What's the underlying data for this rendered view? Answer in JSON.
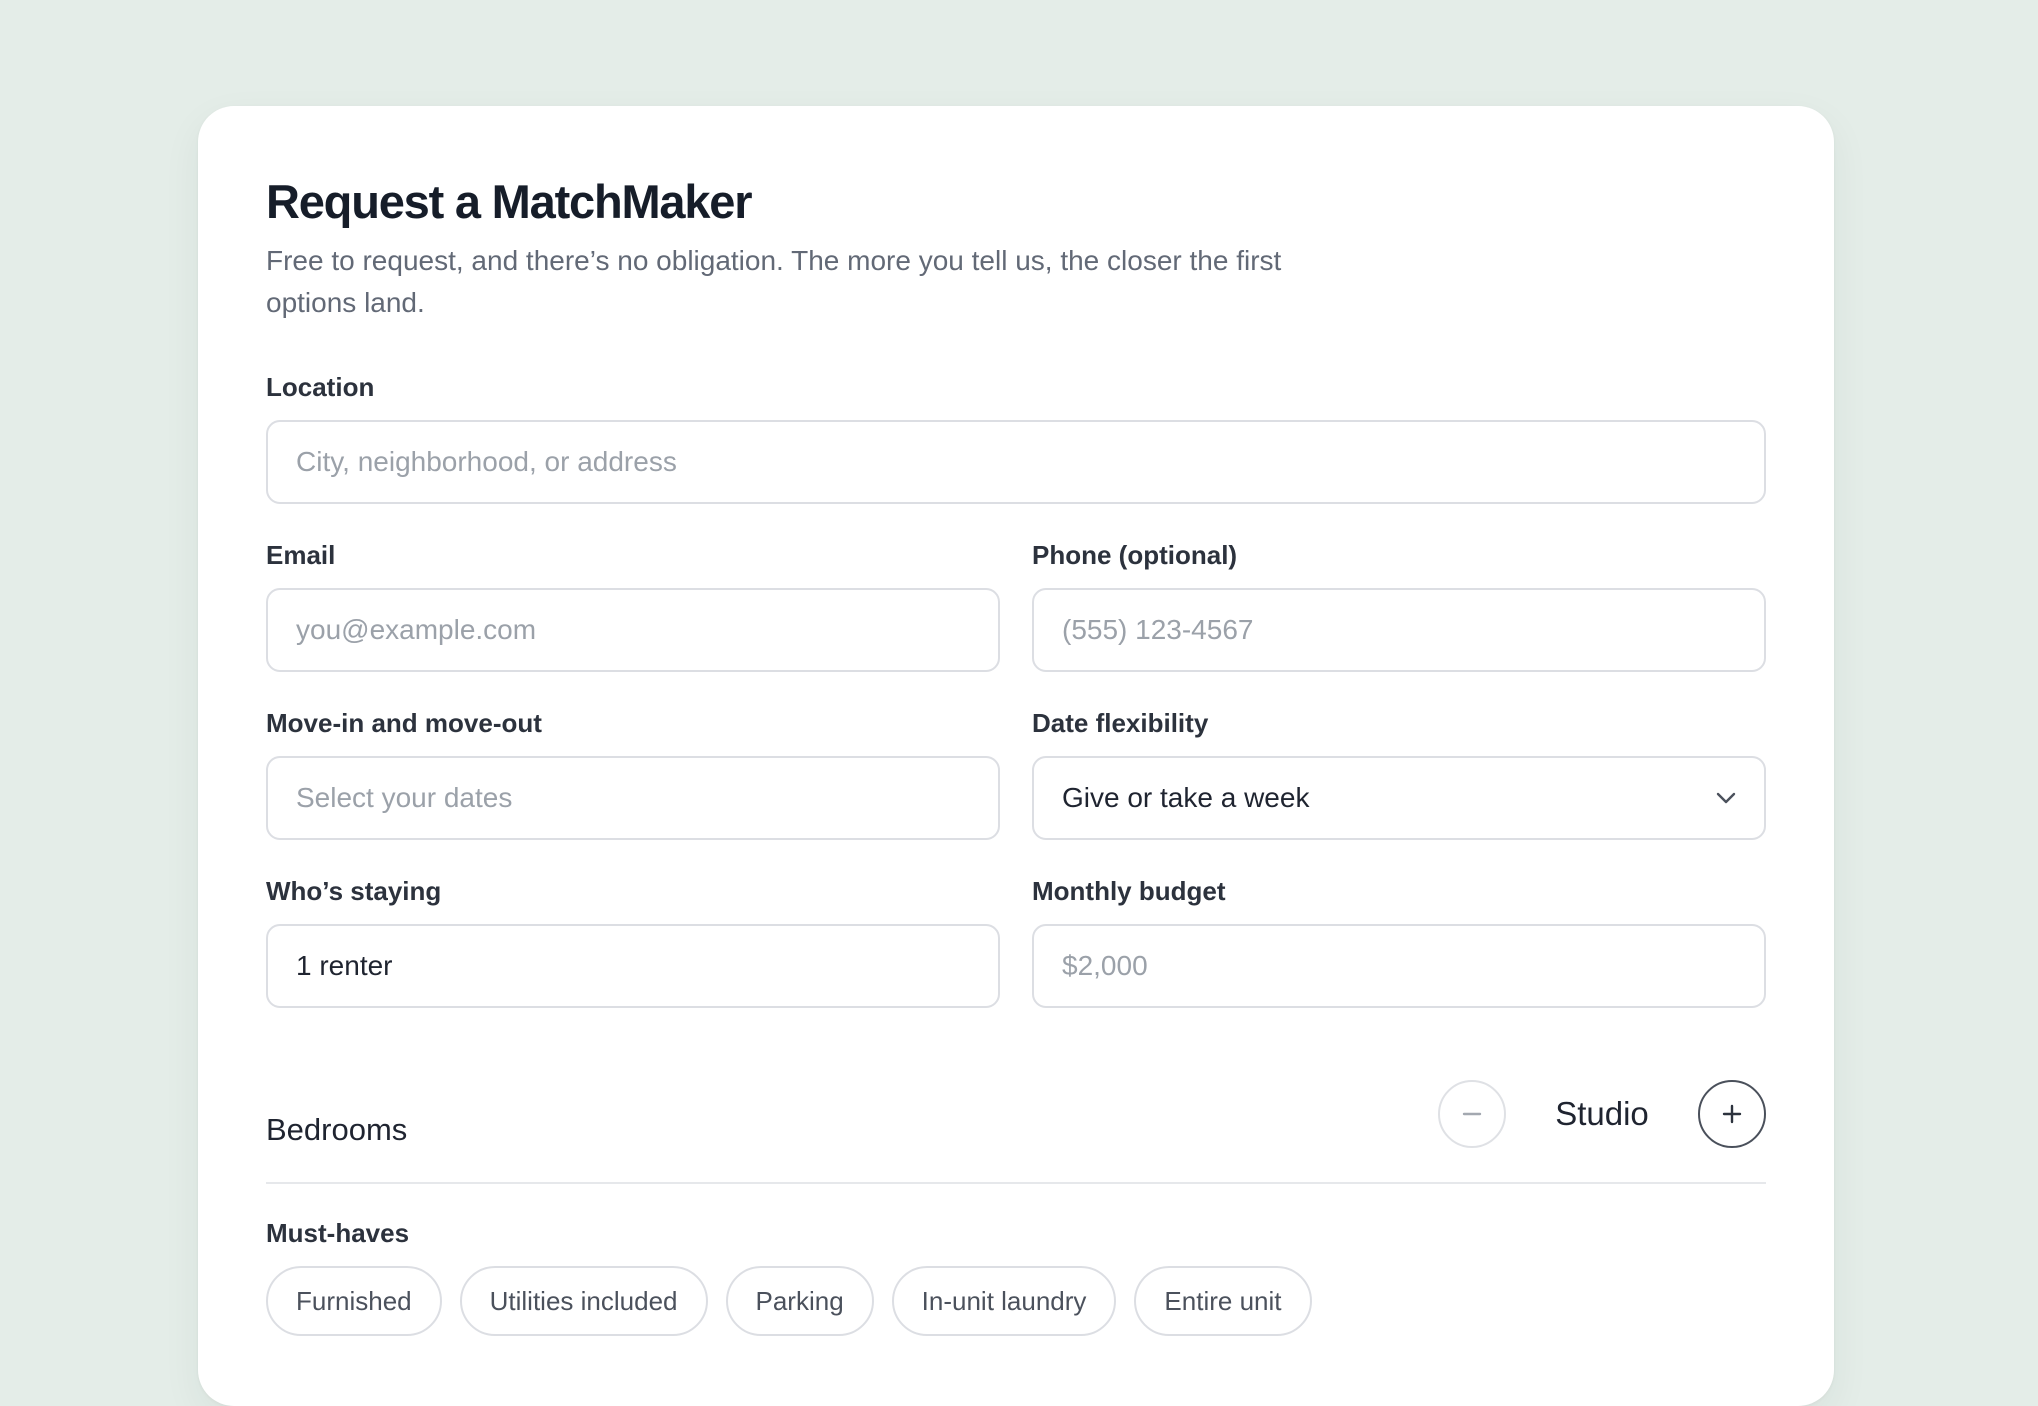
{
  "form": {
    "title": "Request a MatchMaker",
    "subtitle": "Free to request, and there’s no obligation. The more you tell us, the closer the first options land."
  },
  "location": {
    "label": "Location",
    "placeholder": "City, neighborhood, or address"
  },
  "email": {
    "label": "Email",
    "placeholder": "you@example.com"
  },
  "phone": {
    "label": "Phone (optional)",
    "placeholder": "(555) 123-4567"
  },
  "dates": {
    "label": "Move-in and move-out",
    "placeholder": "Select your dates"
  },
  "flexibility": {
    "label": "Date flexibility",
    "selected": "Give or take a week",
    "icon": "chevron-down-icon"
  },
  "guests": {
    "label": "Who’s staying",
    "value": "1 renter"
  },
  "budget": {
    "label": "Monthly budget",
    "placeholder": "$2,000"
  },
  "bedrooms": {
    "label": "Bedrooms",
    "value": "Studio",
    "decrement_icon": "minus-icon",
    "increment_icon": "plus-icon"
  },
  "must_haves": {
    "label": "Must-haves",
    "options": [
      "Furnished",
      "Utilities included",
      "Parking",
      "In-unit laundry",
      "Entire unit"
    ]
  },
  "colors": {
    "background": "#e4ede8",
    "card": "#ffffff",
    "heading": "#161d29",
    "muted_text": "#626976",
    "placeholder": "#9ba1a9",
    "border": "#dcdee3"
  }
}
